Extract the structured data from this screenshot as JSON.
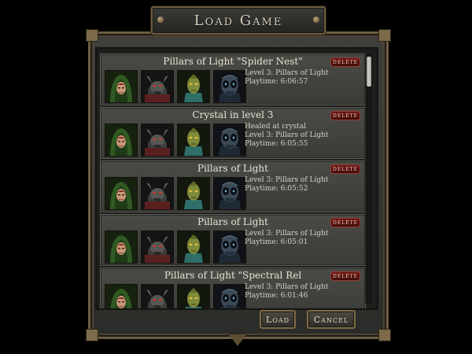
{
  "dialog": {
    "title": "Load Game",
    "load_label": "Load",
    "cancel_label": "Cancel"
  },
  "colors": {
    "frame_gold": "#6f5d3e",
    "slot_bg": "#4a4b47",
    "delete_red": "#6d1a16",
    "text": "#e9e3d2"
  },
  "party_icons": [
    "hooded-archer-portrait-icon",
    "horned-demon-portrait-icon",
    "reptilian-warrior-portrait-icon",
    "alien-skull-portrait-icon"
  ],
  "saves": [
    {
      "title": "Pillars of Light \"Spider Nest\"",
      "delete_label": "DELETE",
      "lines": [
        "Level 3: Pillars of Light",
        "Playtime: 6:06:57"
      ]
    },
    {
      "title": "Crystal in level 3",
      "delete_label": "DELETE",
      "lines": [
        "Healed at crystal",
        "Level 3: Pillars of Light",
        "Playtime: 6:05:55"
      ]
    },
    {
      "title": "Pillars of Light",
      "delete_label": "DELETE",
      "lines": [
        "Level 3: Pillars of Light",
        "Playtime: 6:05:52"
      ]
    },
    {
      "title": "Pillars of Light",
      "delete_label": "DELETE",
      "lines": [
        "Level 3: Pillars of Light",
        "Playtime: 6:05:01"
      ]
    },
    {
      "title": "Pillars of Light \"Spectral Rel",
      "delete_label": "DELETE",
      "lines": [
        "Level 3: Pillars of Light",
        "Playtime: 6:01:46"
      ]
    }
  ]
}
